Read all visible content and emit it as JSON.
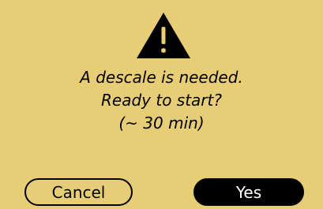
{
  "dialog": {
    "icon": "warning-triangle-icon",
    "message_lines": [
      "A descale is needed.",
      "Ready to start?",
      "(~ 30 min)"
    ],
    "buttons": {
      "cancel_label": "Cancel",
      "yes_label": "Yes"
    }
  },
  "colors": {
    "background": "#e7cd76",
    "primary": "#000000",
    "primary_text": "#ffffff"
  }
}
